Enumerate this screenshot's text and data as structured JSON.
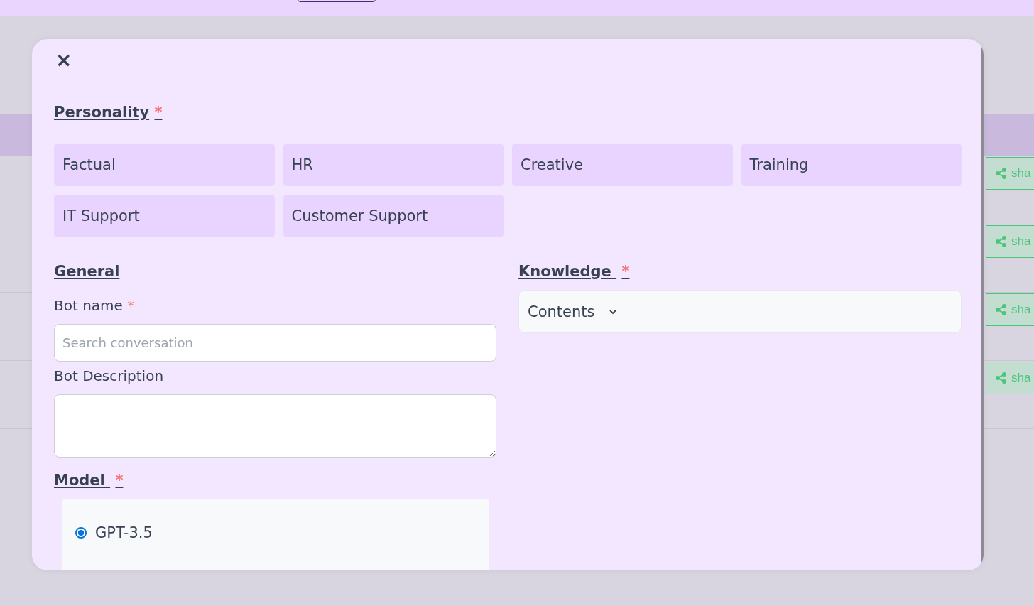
{
  "background": {
    "share_buttons": [
      {
        "label": "sha"
      },
      {
        "label": "sha"
      },
      {
        "label": "sha"
      },
      {
        "label": "sha"
      }
    ]
  },
  "modal": {
    "close": "×",
    "personality": {
      "title": "Personality",
      "required": "*",
      "options": [
        {
          "label": "Factual"
        },
        {
          "label": "HR"
        },
        {
          "label": "Creative"
        },
        {
          "label": "Training"
        },
        {
          "label": "IT Support"
        },
        {
          "label": "Customer Support"
        }
      ]
    },
    "general": {
      "title": "General",
      "bot_name": {
        "label": "Bot name",
        "required": "*",
        "placeholder": "Search conversation"
      },
      "bot_description": {
        "label": "Bot Description"
      }
    },
    "model": {
      "title": "Model",
      "required": "*",
      "options": [
        {
          "label": "GPT-3.5",
          "selected": true
        }
      ]
    },
    "knowledge": {
      "title": "Knowledge",
      "required": "*",
      "dropdown": "Contents"
    }
  }
}
